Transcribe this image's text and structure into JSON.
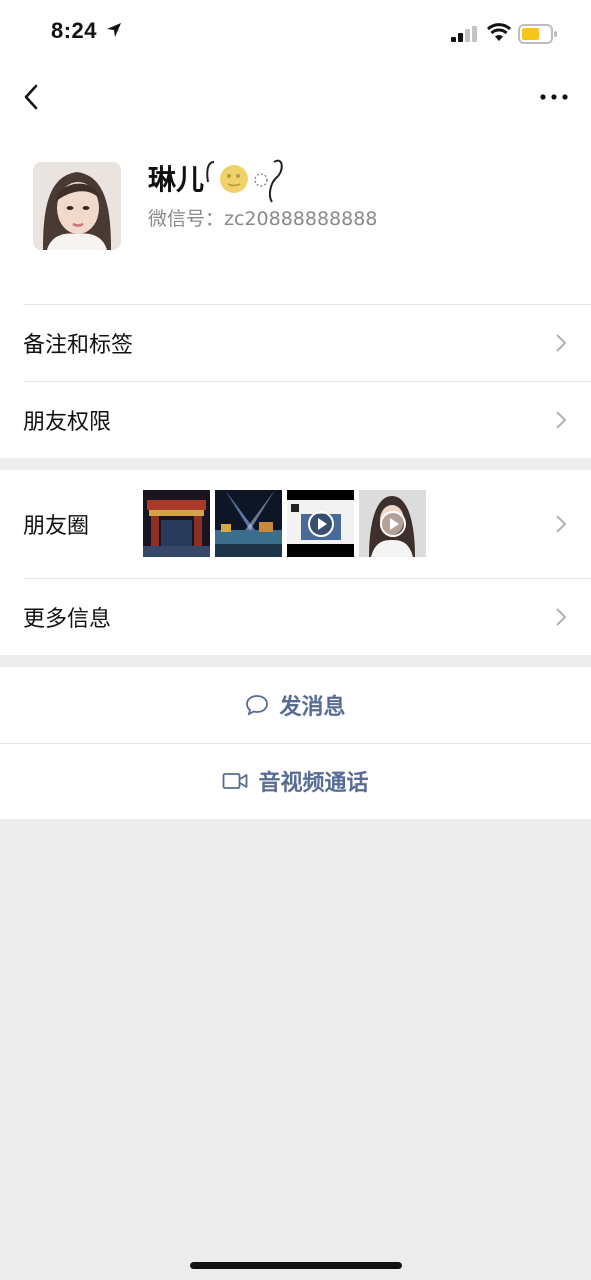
{
  "status_bar": {
    "time": "8:24"
  },
  "profile": {
    "nickname": "琳儿",
    "wechat_id_label": "微信号：",
    "wechat_id": "zc20888888888"
  },
  "rows": {
    "remarks_tags": "备注和标签",
    "friend_permissions": "朋友权限",
    "moments": "朋友圈",
    "more_info": "更多信息"
  },
  "actions": {
    "send_message": "发消息",
    "video_call": "音视频通话"
  },
  "colors": {
    "link_blue": "#576b95",
    "background": "#ededed"
  }
}
